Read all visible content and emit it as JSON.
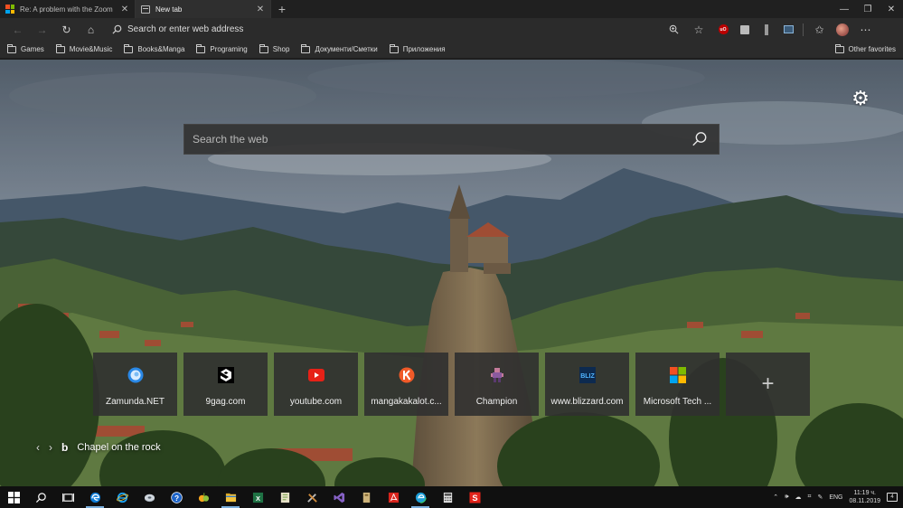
{
  "tabs": [
    {
      "title": "Re: A problem with the Zoom le",
      "icon": "microsoft-icon",
      "active": false
    },
    {
      "title": "New tab",
      "icon": "new-tab-icon",
      "active": true
    }
  ],
  "toolbar": {
    "address_placeholder": "Search or enter web address"
  },
  "favorites": [
    {
      "label": "Games"
    },
    {
      "label": "Movie&Music"
    },
    {
      "label": "Books&Manga"
    },
    {
      "label": "Programing"
    },
    {
      "label": "Shop"
    },
    {
      "label": "Документи/Сметки"
    },
    {
      "label": "Приложения"
    }
  ],
  "favorites_other": "Other favorites",
  "search": {
    "placeholder": "Search the web"
  },
  "tiles": [
    {
      "label": "Zamunda.NET"
    },
    {
      "label": "9gag.com"
    },
    {
      "label": "youtube.com"
    },
    {
      "label": "mangakakalot.c..."
    },
    {
      "label": "Champion"
    },
    {
      "label": "www.blizzard.com"
    },
    {
      "label": "Microsoft Tech ..."
    }
  ],
  "caption": {
    "text": "Chapel on the rock"
  },
  "taskbar": {
    "language": "ENG",
    "time": "11:19 ч.",
    "date": "08.11.2019",
    "notifications": "4"
  },
  "colors": {
    "accent": "#0078d7",
    "youtube": "#e62117",
    "ublock": "#b00000"
  }
}
